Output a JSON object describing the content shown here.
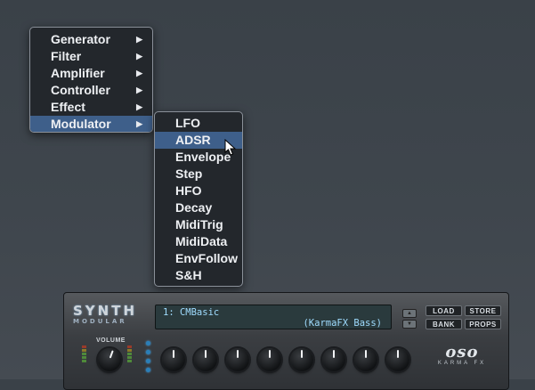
{
  "main_menu": {
    "items": [
      {
        "label": "Generator",
        "arrow": "▶"
      },
      {
        "label": "Filter",
        "arrow": "▶"
      },
      {
        "label": "Amplifier",
        "arrow": "▶"
      },
      {
        "label": "Controller",
        "arrow": "▶"
      },
      {
        "label": "Effect",
        "arrow": "▶"
      },
      {
        "label": "Modulator",
        "arrow": "▶",
        "highlighted": true
      }
    ]
  },
  "sub_menu": {
    "items": [
      {
        "label": "LFO"
      },
      {
        "label": "ADSR",
        "highlighted": true
      },
      {
        "label": "Envelope"
      },
      {
        "label": "Step"
      },
      {
        "label": "HFO"
      },
      {
        "label": "Decay"
      },
      {
        "label": "MidiTrig"
      },
      {
        "label": "MidiData"
      },
      {
        "label": "EnvFollow"
      },
      {
        "label": "S&H"
      }
    ]
  },
  "synth": {
    "logo_top": "SYNTH",
    "logo_bottom": "MODULAR",
    "display": {
      "line1": "1: CMBasic",
      "line2": "(KarmaFX Bass)"
    },
    "buttons": {
      "load": "LOAD",
      "store": "STORE",
      "bank": "BANK",
      "props": "PROPS"
    },
    "volume_label": "VOLUME",
    "brand_mark": "oso",
    "brand_sub": "KARMA FX"
  },
  "colors": {
    "menu_bg": "#23272c",
    "menu_highlight": "#3e5f8a",
    "lcd_text": "#9fdcff",
    "led": "#2a7fb8"
  },
  "icons": {
    "submenu_arrow": "arrow-right-icon",
    "cursor": "mouse-pointer-icon"
  }
}
